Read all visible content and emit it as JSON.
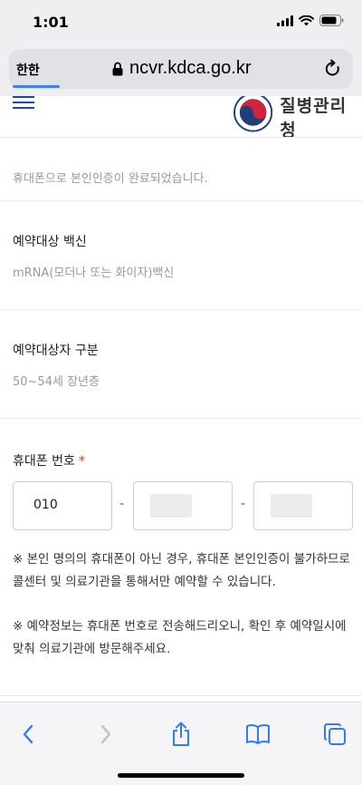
{
  "status_bar": {
    "time": "1:01"
  },
  "url_bar": {
    "text_size_label": "한한",
    "domain": "ncvr.kdca.go.kr"
  },
  "site_header": {
    "logo_text": "질병관리청"
  },
  "auth_message": "휴대폰으로 본인인증이 완료되었습니다.",
  "vaccine": {
    "label": "예약대상 백신",
    "value": "mRNA(모더나 또는 화이자)백신"
  },
  "target_group": {
    "label": "예약대상자 구분",
    "value": "50~54세 장년층"
  },
  "phone": {
    "label": "휴대폰 번호",
    "required_mark": "*",
    "part1": "010",
    "separator": "-"
  },
  "notes": [
    "※ 본인 명의의 휴대폰이 아닌 경우, 휴대폰 본인인증이 불가하므로 콜센터 및 의료기관을 통해서만 예약할 수 있습니다.",
    "※ 예약정보는 휴대폰 번호로 전송해드리오니, 확인 후 예약일시에 맞춰 의료기관에 방문해주세요."
  ],
  "toolbar_icons": [
    "back-icon",
    "forward-icon",
    "share-icon",
    "bookmarks-icon",
    "tabs-icon"
  ]
}
